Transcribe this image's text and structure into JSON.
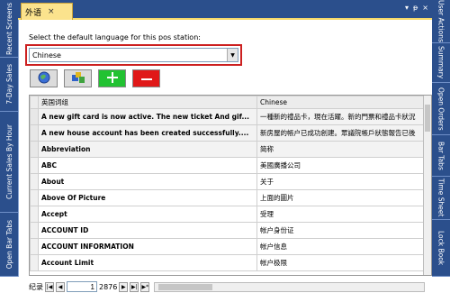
{
  "left_tabs": [
    "Recent Screens",
    "7-Day Sales",
    "Current Sales By Hour",
    "Open Bar Tabs"
  ],
  "right_tabs": [
    "User Actions",
    "Summary",
    "Open Orders",
    "Bar Tabs",
    "Time Sheet",
    "Lock Book"
  ],
  "doc_tab": {
    "title": "外语",
    "close": "×"
  },
  "window_buttons": [
    "▾",
    "ᵽ",
    "×"
  ],
  "prompt": "Select the default language for this pos station:",
  "language_select": {
    "value": "Chinese"
  },
  "toolbar": {
    "icons": [
      "globe-icon",
      "edit-icon",
      "plus-icon",
      "minus-icon"
    ]
  },
  "grid": {
    "columns": [
      "英国词组",
      "Chinese"
    ],
    "rows": [
      [
        "A new gift card is now active. The new ticket And gif...",
        "一種新的禮品卡，現在活躍。新的門票和禮品卡狀況"
      ],
      [
        "A new house account has been created successfully....",
        "新房屋的帳户已成功創建。眾議院帳戶狀態報告已後"
      ],
      [
        "Abbreviation",
        "简称"
      ],
      [
        "ABC",
        "美國廣播公司"
      ],
      [
        "About",
        "关于"
      ],
      [
        "Above Of Picture",
        "上面的圖片"
      ],
      [
        "Accept",
        "受理"
      ],
      [
        "ACCOUNT ID",
        "帐户身份证"
      ],
      [
        "ACCOUNT INFORMATION",
        "帐户信息"
      ],
      [
        "Account Limit",
        "帐户极限"
      ]
    ]
  },
  "navigator": {
    "label": "纪录",
    "page": "1",
    "total": "2876"
  }
}
